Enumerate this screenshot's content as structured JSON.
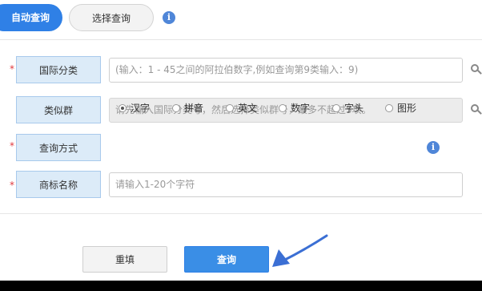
{
  "tabs": {
    "auto_query": "自动查询",
    "select_query": "选择查询"
  },
  "info_icon_glyph": "i",
  "form": {
    "required_mark": "*",
    "intl_class": {
      "label": "国际分类",
      "placeholder": "(输入：1 - 45之间的阿拉伯数字,例如查询第9类输入：9)"
    },
    "similar_group": {
      "label": "类似群",
      "placeholder": "请先输入国际分类号，然后选择类似群号，最多不超过5项。"
    },
    "query_method": {
      "label": "查询方式",
      "options": [
        "汉字",
        "拼音",
        "英文",
        "数字",
        "字头",
        "图形"
      ],
      "selected": "汉字"
    },
    "trademark_name": {
      "label": "商标名称",
      "placeholder": "请输入1-20个字符"
    }
  },
  "buttons": {
    "reset": "重填",
    "query": "查询"
  },
  "colors": {
    "accent": "#2f80e6",
    "label_bg": "#dcebf8",
    "required": "#e0393e",
    "arrow": "#3b6fd4"
  }
}
